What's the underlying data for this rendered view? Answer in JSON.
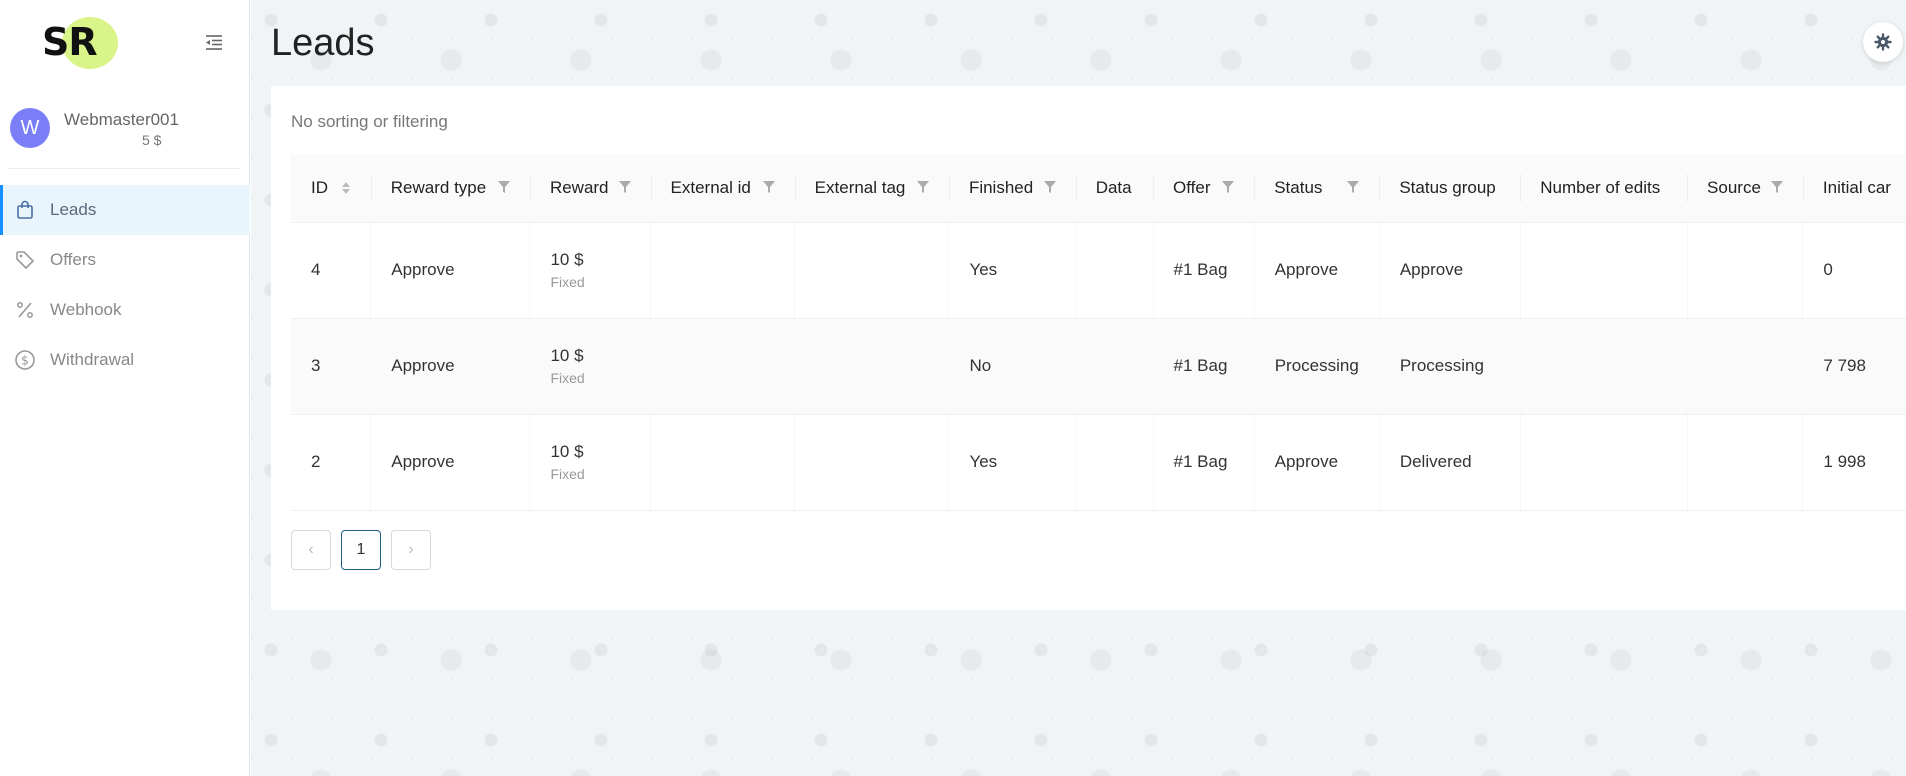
{
  "logo": {
    "text": "SR"
  },
  "user": {
    "initial": "W",
    "name": "Webmaster001",
    "balance": "5 $"
  },
  "nav": [
    {
      "label": "Leads",
      "icon": "shopping-bag-icon",
      "active": true
    },
    {
      "label": "Offers",
      "icon": "tag-icon",
      "active": false
    },
    {
      "label": "Webhook",
      "icon": "percent-icon",
      "active": false
    },
    {
      "label": "Withdrawal",
      "icon": "dollar-circle-icon",
      "active": false
    }
  ],
  "page": {
    "title": "Leads",
    "filter_note": "No sorting or filtering"
  },
  "table": {
    "columns": [
      {
        "label": "ID",
        "control": "sort"
      },
      {
        "label": "Reward type",
        "control": "filter"
      },
      {
        "label": "Reward",
        "control": "filter"
      },
      {
        "label": "External id",
        "control": "filter"
      },
      {
        "label": "External tag",
        "control": "filter"
      },
      {
        "label": "Finished",
        "control": "filter"
      },
      {
        "label": "Data",
        "control": "none"
      },
      {
        "label": "Offer",
        "control": "filter"
      },
      {
        "label": "Status",
        "control": "filter"
      },
      {
        "label": "Status group",
        "control": "none"
      },
      {
        "label": "Number of edits",
        "control": "none"
      },
      {
        "label": "Source",
        "control": "filter"
      },
      {
        "label": "Initial car",
        "control": "none"
      }
    ],
    "rows": [
      {
        "id": "4",
        "reward_type": "Approve",
        "reward": "10 $",
        "reward_sub": "Fixed",
        "external_id": "",
        "external_tag": "",
        "finished": "Yes",
        "data": "",
        "offer": "#1 Bag",
        "status": "Approve",
        "status_group": "Approve",
        "edits": "",
        "source": "",
        "initial": "0"
      },
      {
        "id": "3",
        "reward_type": "Approve",
        "reward": "10 $",
        "reward_sub": "Fixed",
        "external_id": "",
        "external_tag": "",
        "finished": "No",
        "data": "",
        "offer": "#1 Bag",
        "status": "Processing",
        "status_group": "Processing",
        "edits": "",
        "source": "",
        "initial": "7 798"
      },
      {
        "id": "2",
        "reward_type": "Approve",
        "reward": "10 $",
        "reward_sub": "Fixed",
        "external_id": "",
        "external_tag": "",
        "finished": "Yes",
        "data": "",
        "offer": "#1 Bag",
        "status": "Approve",
        "status_group": "Delivered",
        "edits": "",
        "source": "",
        "initial": "1 998"
      }
    ]
  },
  "pagination": {
    "prev": "‹",
    "current": "1",
    "next": "›"
  },
  "colors": {
    "accent": "#1890ff",
    "logo_bg": "#d9f58a",
    "avatar_bg": "#7b7ff7",
    "active_bg": "#e8f5fd"
  }
}
